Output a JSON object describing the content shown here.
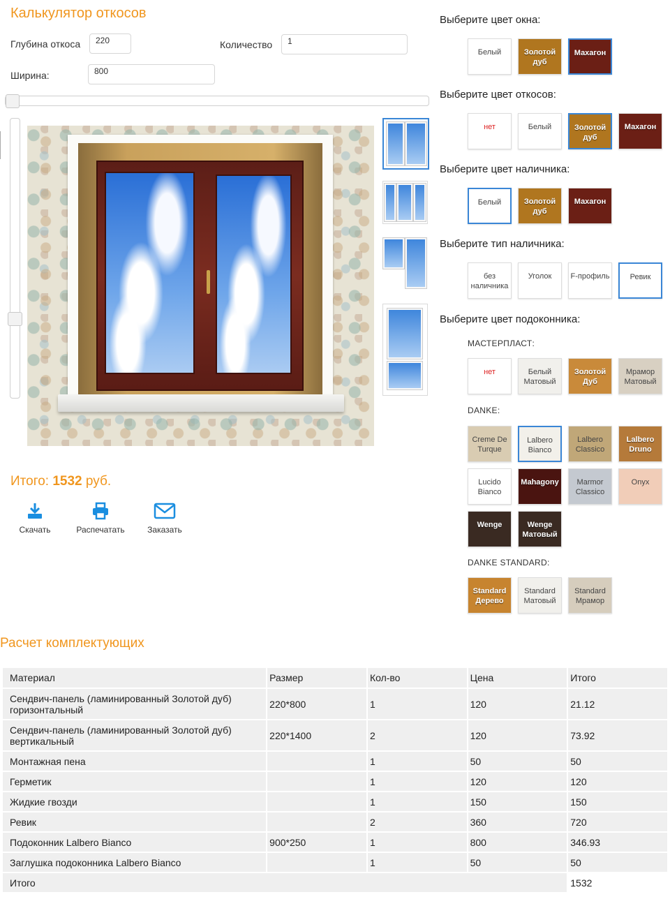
{
  "calculator": {
    "title": "Калькулятор откосов",
    "depth_label": "Глубина откоса",
    "depth_value": "220",
    "qty_label": "Количество",
    "qty_value": "1",
    "width_label": "Ширина:",
    "width_value": "800",
    "total_label": "Итого:",
    "total_value": "1532",
    "total_unit": "руб.",
    "actions": {
      "download": "Скачать",
      "print": "Распечатать",
      "order": "Заказать"
    },
    "slider_width_fraction": 0.0,
    "slider_height_fraction": 0.73
  },
  "options": {
    "window_color": {
      "title": "Выберите цвет окна:",
      "items": [
        {
          "label": "Белый",
          "color": "#ffffff",
          "selected": false
        },
        {
          "label": "Золотой дуб",
          "color": "#b0761f",
          "selected": false
        },
        {
          "label": "Махагон",
          "color": "#6b1f15",
          "selected": true
        }
      ]
    },
    "slope_color": {
      "title": "Выберите цвет откосов:",
      "items": [
        {
          "label": "нет",
          "color": "#ffffff",
          "selected": false
        },
        {
          "label": "Белый",
          "color": "#ffffff",
          "selected": false
        },
        {
          "label": "Золотой дуб",
          "color": "#b0761f",
          "selected": true
        },
        {
          "label": "Махагон",
          "color": "#6b1f15",
          "selected": false
        }
      ]
    },
    "casing_color": {
      "title": "Выберите цвет наличника:",
      "items": [
        {
          "label": "Белый",
          "color": "#ffffff",
          "selected": true
        },
        {
          "label": "Золотой дуб",
          "color": "#b0761f",
          "selected": false
        },
        {
          "label": "Махагон",
          "color": "#6b1f15",
          "selected": false
        }
      ]
    },
    "casing_type": {
      "title": "Выберите тип наличника:",
      "items": [
        {
          "label": "без наличника",
          "selected": false
        },
        {
          "label": "Уголок",
          "selected": false
        },
        {
          "label": "F-профиль",
          "selected": false
        },
        {
          "label": "Ревик",
          "selected": true
        }
      ]
    },
    "sill_color": {
      "title": "Выберите цвет подоконника:",
      "groups": [
        {
          "name": "МАСТЕРПЛАСТ:",
          "items": [
            {
              "label": "нет",
              "color": "#ffffff"
            },
            {
              "label": "Белый Матовый",
              "color": "#f1f0ec"
            },
            {
              "label": "Золотой Дуб",
              "color": "#c98a3a"
            },
            {
              "label": "Мрамор Матовый",
              "color": "#d8d0c2"
            }
          ]
        },
        {
          "name": "DANKE:",
          "items": [
            {
              "label": "Creme De Turque",
              "color": "#d9ccb2"
            },
            {
              "label": "Lalbero Bianco",
              "color": "#f2f0ea",
              "selected": true
            },
            {
              "label": "Lalbero Classico",
              "color": "#c0a778"
            },
            {
              "label": "Lalbero Druno",
              "color": "#b57a3a"
            },
            {
              "label": "Lucido Bianco",
              "color": "#ffffff"
            },
            {
              "label": "Mahagony",
              "color": "#4a1410"
            },
            {
              "label": "Marmor Classico",
              "color": "#c4c9d0"
            },
            {
              "label": "Onyx",
              "color": "#f1cdb8"
            },
            {
              "label": "Wenge",
              "color": "#3a2a22"
            },
            {
              "label": "Wenge Матовый",
              "color": "#3a2a22"
            }
          ]
        },
        {
          "name": "DANKE STANDARD:",
          "items": [
            {
              "label": "Standard Дерево",
              "color": "#c7842f"
            },
            {
              "label": "Standard Матовый",
              "color": "#f1f0ec"
            },
            {
              "label": "Standard Мрамор",
              "color": "#d6cdbd"
            }
          ]
        }
      ]
    }
  },
  "components": {
    "title": "Расчет комплектующих",
    "headers": [
      "Материал",
      "Размер",
      "Кол-во",
      "Цена",
      "Итого"
    ],
    "rows": [
      [
        "Сендвич-панель (ламинированный Золотой дуб) горизонтальный",
        "220*800",
        "1",
        "120",
        "21.12"
      ],
      [
        "Сендвич-панель (ламинированный Золотой дуб) вертикальный",
        "220*1400",
        "2",
        "120",
        "73.92"
      ],
      [
        "Монтажная пена",
        "",
        "1",
        "50",
        "50"
      ],
      [
        "Герметик",
        "",
        "1",
        "120",
        "120"
      ],
      [
        "Жидкие гвозди",
        "",
        "1",
        "150",
        "150"
      ],
      [
        "Ревик",
        "",
        "2",
        "360",
        "720"
      ],
      [
        "Подоконник Lalbero Bianco",
        "900*250",
        "1",
        "800",
        "346.93"
      ],
      [
        "Заглушка подоконника Lalbero Bianco",
        "",
        "1",
        "50",
        "50"
      ]
    ],
    "footer_label": "Итого",
    "footer_total": "1532"
  }
}
